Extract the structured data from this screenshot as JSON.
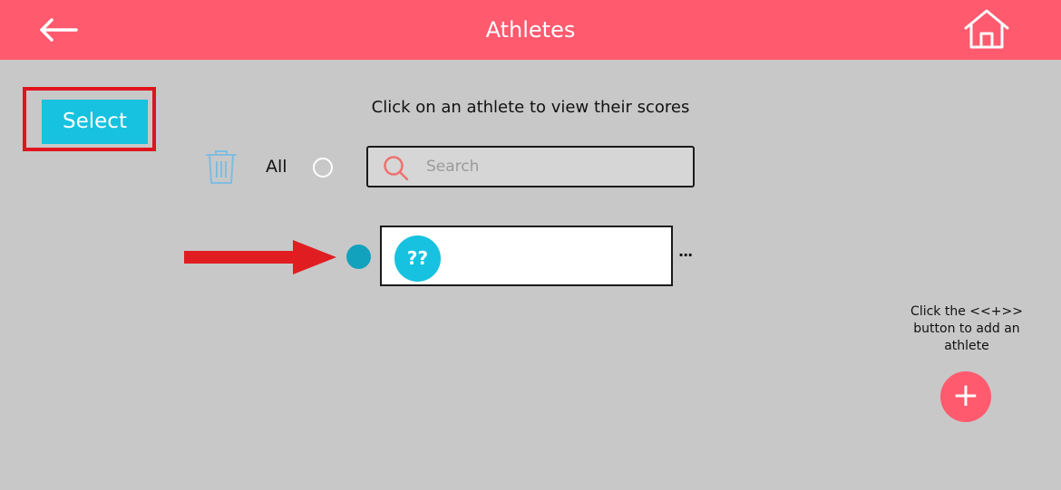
{
  "header": {
    "title": "Athletes",
    "back_icon": "back-arrow-icon",
    "home_icon": "home-icon",
    "color": "#ff5a6e"
  },
  "toolbar": {
    "select_label": "Select"
  },
  "instruction": "Click on an athlete to view their scores",
  "filters": {
    "all_label": "All",
    "trash_icon": "trash-icon"
  },
  "search": {
    "placeholder": "Search",
    "value": ""
  },
  "athletes": [
    {
      "avatar_text": "??",
      "name": ""
    }
  ],
  "more_label": "...",
  "add": {
    "hint": "Click the <<+>> button to add an athlete",
    "label": "+"
  },
  "colors": {
    "accent": "#16c2df",
    "header": "#ff5a6e",
    "annotation": "#e0141e",
    "background": "#c8c8c8"
  }
}
